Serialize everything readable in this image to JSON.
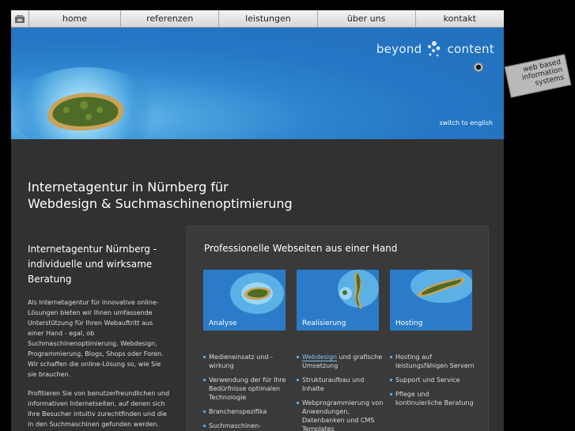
{
  "nav": {
    "items": [
      "home",
      "referenzen",
      "leistungen",
      "über uns",
      "kontakt"
    ]
  },
  "banner": {
    "logo_left": "beyond",
    "logo_right": "content",
    "switch_language": "switch to english"
  },
  "tag": {
    "lines": [
      "web based",
      "information",
      "systems"
    ]
  },
  "headline": {
    "line1": "Internetagentur in Nürnberg für",
    "line2": "Webdesign & Suchmaschinenoptimierung"
  },
  "left": {
    "lead": "Internetagentur Nürnberg - individuelle und wirksame Beratung",
    "p1": "Als Internetagentur für innovative online-Lösungen bieten wir Ihnen umfassende Unterstützung für Ihren Webauftritt aus einer Hand - egal, ob Suchmaschinenoptimierung, Webdesign, Programmierung, Blogs, Shops oder Foren. Wir schaffen die online-Lösung so, wie Sie sie brauchen.",
    "p2": "Profitieren Sie von benutzerfreundlichen und informativen Internetseiten, auf denen sich Ihre Besucher intuitiv zurechtfinden und die in den Suchmaschinen gefunden werden."
  },
  "box": {
    "title": "Professionelle Webseiten aus einer Hand",
    "tiles": [
      "Analyse",
      "Realisierung",
      "Hosting"
    ],
    "col1": [
      "Medieneinsatz und -wirkung",
      "Verwendung der für Ihre Bedürfnisse optimalen Technologie",
      "Branchenspezifika",
      "Suchmaschinen-"
    ],
    "col2_link": "Webdesign",
    "col2_first_rest": " und grafische Umsetzung",
    "col2": [
      "Strukturaufbau und Inhalte",
      "Webprogrammierung von Anwendungen, Datenbanken und CMS Templates"
    ],
    "col3": [
      "Hosting auf leistungsfähigen Servern",
      "Support und Service",
      "Pflege und kontinuierliche Beratung"
    ]
  },
  "colors": {
    "banner_blue": "#2576c4",
    "nav_bg": "#e6e6e6",
    "page_bg": "#313131",
    "link": "#7fc1f0"
  }
}
